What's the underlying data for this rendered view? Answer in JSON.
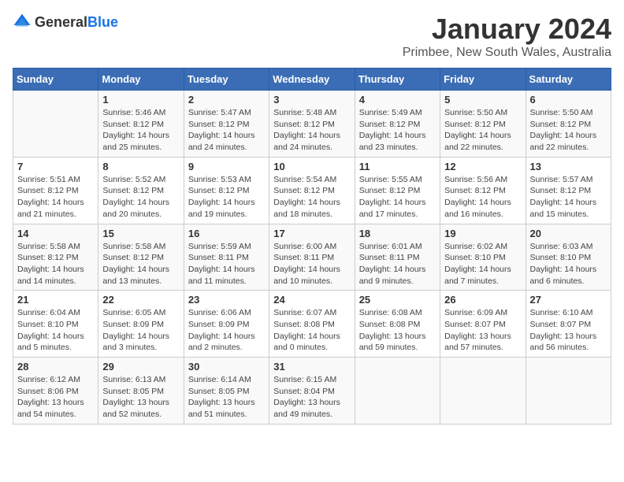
{
  "logo": {
    "general": "General",
    "blue": "Blue"
  },
  "header": {
    "month": "January 2024",
    "location": "Primbee, New South Wales, Australia"
  },
  "days_of_week": [
    "Sunday",
    "Monday",
    "Tuesday",
    "Wednesday",
    "Thursday",
    "Friday",
    "Saturday"
  ],
  "weeks": [
    [
      {
        "day": "",
        "info": ""
      },
      {
        "day": "1",
        "info": "Sunrise: 5:46 AM\nSunset: 8:12 PM\nDaylight: 14 hours\nand 25 minutes."
      },
      {
        "day": "2",
        "info": "Sunrise: 5:47 AM\nSunset: 8:12 PM\nDaylight: 14 hours\nand 24 minutes."
      },
      {
        "day": "3",
        "info": "Sunrise: 5:48 AM\nSunset: 8:12 PM\nDaylight: 14 hours\nand 24 minutes."
      },
      {
        "day": "4",
        "info": "Sunrise: 5:49 AM\nSunset: 8:12 PM\nDaylight: 14 hours\nand 23 minutes."
      },
      {
        "day": "5",
        "info": "Sunrise: 5:50 AM\nSunset: 8:12 PM\nDaylight: 14 hours\nand 22 minutes."
      },
      {
        "day": "6",
        "info": "Sunrise: 5:50 AM\nSunset: 8:12 PM\nDaylight: 14 hours\nand 22 minutes."
      }
    ],
    [
      {
        "day": "7",
        "info": "Sunrise: 5:51 AM\nSunset: 8:12 PM\nDaylight: 14 hours\nand 21 minutes."
      },
      {
        "day": "8",
        "info": "Sunrise: 5:52 AM\nSunset: 8:12 PM\nDaylight: 14 hours\nand 20 minutes."
      },
      {
        "day": "9",
        "info": "Sunrise: 5:53 AM\nSunset: 8:12 PM\nDaylight: 14 hours\nand 19 minutes."
      },
      {
        "day": "10",
        "info": "Sunrise: 5:54 AM\nSunset: 8:12 PM\nDaylight: 14 hours\nand 18 minutes."
      },
      {
        "day": "11",
        "info": "Sunrise: 5:55 AM\nSunset: 8:12 PM\nDaylight: 14 hours\nand 17 minutes."
      },
      {
        "day": "12",
        "info": "Sunrise: 5:56 AM\nSunset: 8:12 PM\nDaylight: 14 hours\nand 16 minutes."
      },
      {
        "day": "13",
        "info": "Sunrise: 5:57 AM\nSunset: 8:12 PM\nDaylight: 14 hours\nand 15 minutes."
      }
    ],
    [
      {
        "day": "14",
        "info": "Sunrise: 5:58 AM\nSunset: 8:12 PM\nDaylight: 14 hours\nand 14 minutes."
      },
      {
        "day": "15",
        "info": "Sunrise: 5:58 AM\nSunset: 8:12 PM\nDaylight: 14 hours\nand 13 minutes."
      },
      {
        "day": "16",
        "info": "Sunrise: 5:59 AM\nSunset: 8:11 PM\nDaylight: 14 hours\nand 11 minutes."
      },
      {
        "day": "17",
        "info": "Sunrise: 6:00 AM\nSunset: 8:11 PM\nDaylight: 14 hours\nand 10 minutes."
      },
      {
        "day": "18",
        "info": "Sunrise: 6:01 AM\nSunset: 8:11 PM\nDaylight: 14 hours\nand 9 minutes."
      },
      {
        "day": "19",
        "info": "Sunrise: 6:02 AM\nSunset: 8:10 PM\nDaylight: 14 hours\nand 7 minutes."
      },
      {
        "day": "20",
        "info": "Sunrise: 6:03 AM\nSunset: 8:10 PM\nDaylight: 14 hours\nand 6 minutes."
      }
    ],
    [
      {
        "day": "21",
        "info": "Sunrise: 6:04 AM\nSunset: 8:10 PM\nDaylight: 14 hours\nand 5 minutes."
      },
      {
        "day": "22",
        "info": "Sunrise: 6:05 AM\nSunset: 8:09 PM\nDaylight: 14 hours\nand 3 minutes."
      },
      {
        "day": "23",
        "info": "Sunrise: 6:06 AM\nSunset: 8:09 PM\nDaylight: 14 hours\nand 2 minutes."
      },
      {
        "day": "24",
        "info": "Sunrise: 6:07 AM\nSunset: 8:08 PM\nDaylight: 14 hours\nand 0 minutes."
      },
      {
        "day": "25",
        "info": "Sunrise: 6:08 AM\nSunset: 8:08 PM\nDaylight: 13 hours\nand 59 minutes."
      },
      {
        "day": "26",
        "info": "Sunrise: 6:09 AM\nSunset: 8:07 PM\nDaylight: 13 hours\nand 57 minutes."
      },
      {
        "day": "27",
        "info": "Sunrise: 6:10 AM\nSunset: 8:07 PM\nDaylight: 13 hours\nand 56 minutes."
      }
    ],
    [
      {
        "day": "28",
        "info": "Sunrise: 6:12 AM\nSunset: 8:06 PM\nDaylight: 13 hours\nand 54 minutes."
      },
      {
        "day": "29",
        "info": "Sunrise: 6:13 AM\nSunset: 8:05 PM\nDaylight: 13 hours\nand 52 minutes."
      },
      {
        "day": "30",
        "info": "Sunrise: 6:14 AM\nSunset: 8:05 PM\nDaylight: 13 hours\nand 51 minutes."
      },
      {
        "day": "31",
        "info": "Sunrise: 6:15 AM\nSunset: 8:04 PM\nDaylight: 13 hours\nand 49 minutes."
      },
      {
        "day": "",
        "info": ""
      },
      {
        "day": "",
        "info": ""
      },
      {
        "day": "",
        "info": ""
      }
    ]
  ]
}
